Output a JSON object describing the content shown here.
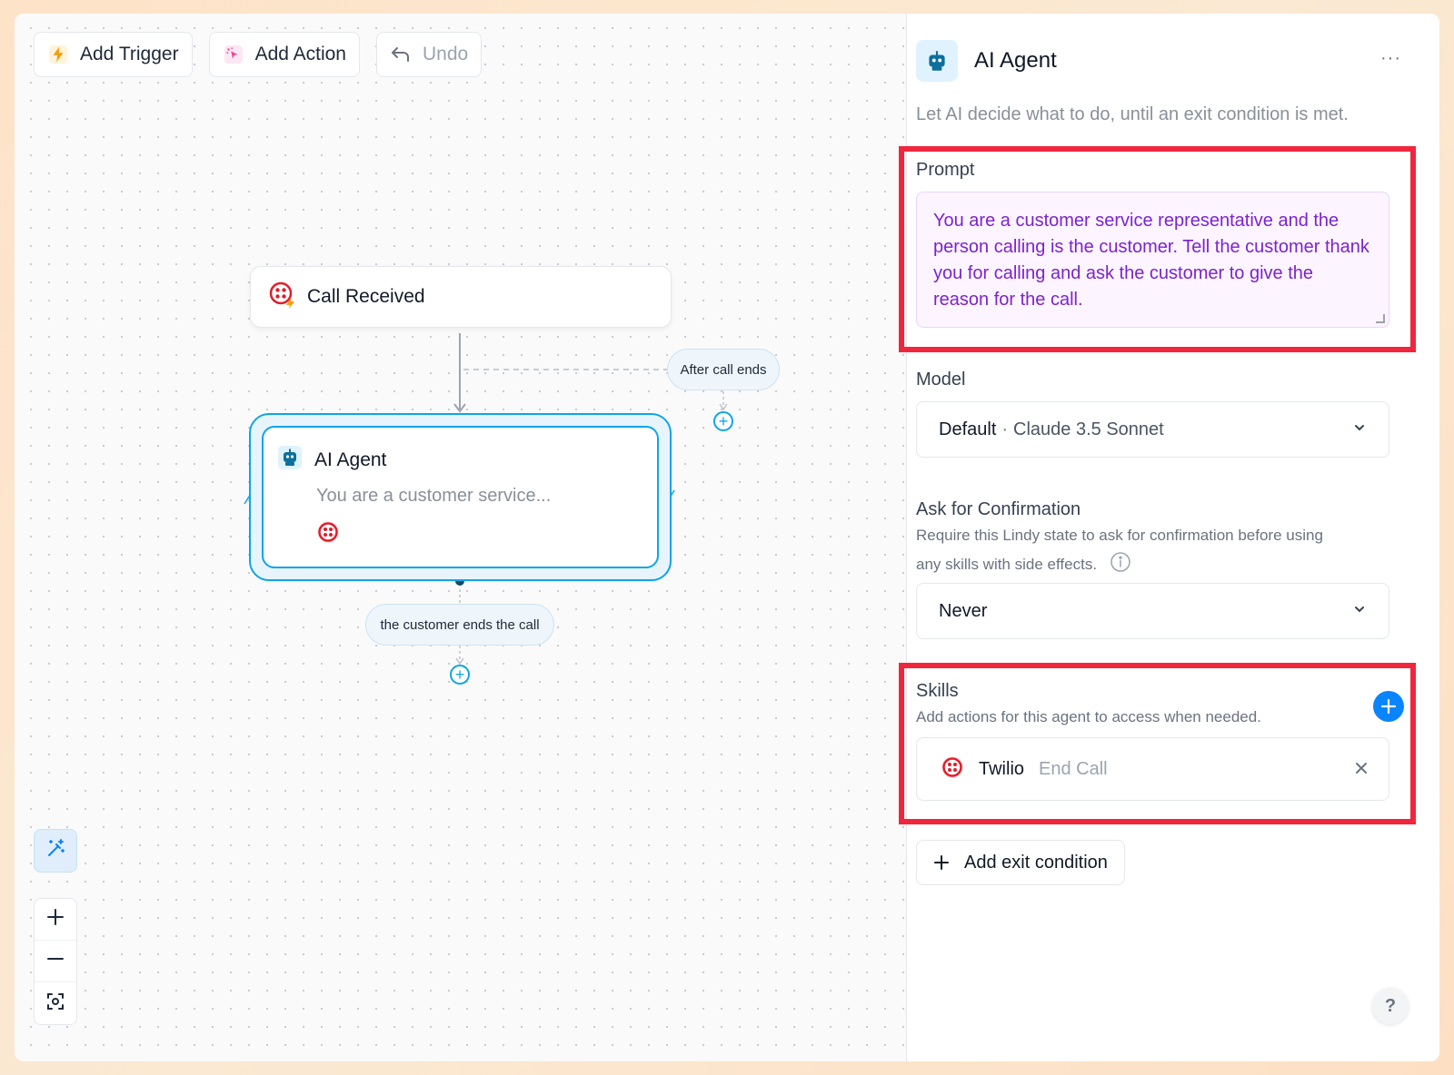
{
  "toolbar": {
    "add_trigger": "Add Trigger",
    "add_action": "Add Action",
    "undo": "Undo"
  },
  "canvas": {
    "trigger_node": {
      "title": "Call Received",
      "icon": "twilio-icon"
    },
    "agent_node": {
      "title": "AI Agent",
      "description": "You are a customer service...",
      "icon": "robot-icon",
      "skill_icon": "twilio-icon"
    },
    "branch_after_call": "After call ends",
    "exit_condition_pill": "the customer ends the call",
    "zoom": {
      "ai_tidy": "magic-wand-icon",
      "zoom_in": "+",
      "zoom_out": "−",
      "fit_view": "fit-view-icon"
    }
  },
  "panel": {
    "title": "AI Agent",
    "more": "···",
    "subtitle": "Let AI decide what to do, until an exit condition is met.",
    "prompt": {
      "label": "Prompt",
      "value": "You are a customer service representative and the person calling is the customer. Tell the customer thank you for calling and ask the customer to give the reason for the call."
    },
    "model": {
      "label": "Model",
      "selected_main": "Default",
      "separator": "·",
      "selected_sub": "Claude 3.5 Sonnet"
    },
    "confirmation": {
      "label": "Ask for Confirmation",
      "hint_line1": "Require this Lindy state to ask for confirmation before using",
      "hint_line2": "any skills with side effects.",
      "selected": "Never"
    },
    "skills": {
      "label": "Skills",
      "hint": "Add actions for this agent to access when needed.",
      "items": [
        {
          "provider": "Twilio",
          "action": "End Call"
        }
      ]
    },
    "add_exit_condition": "Add exit condition",
    "help": "?"
  },
  "colors": {
    "accent_blue": "#0ea5e9",
    "highlight_red": "#f0263d",
    "prompt_purple": "#7e22ce",
    "twilio_red": "#e11d2a"
  }
}
